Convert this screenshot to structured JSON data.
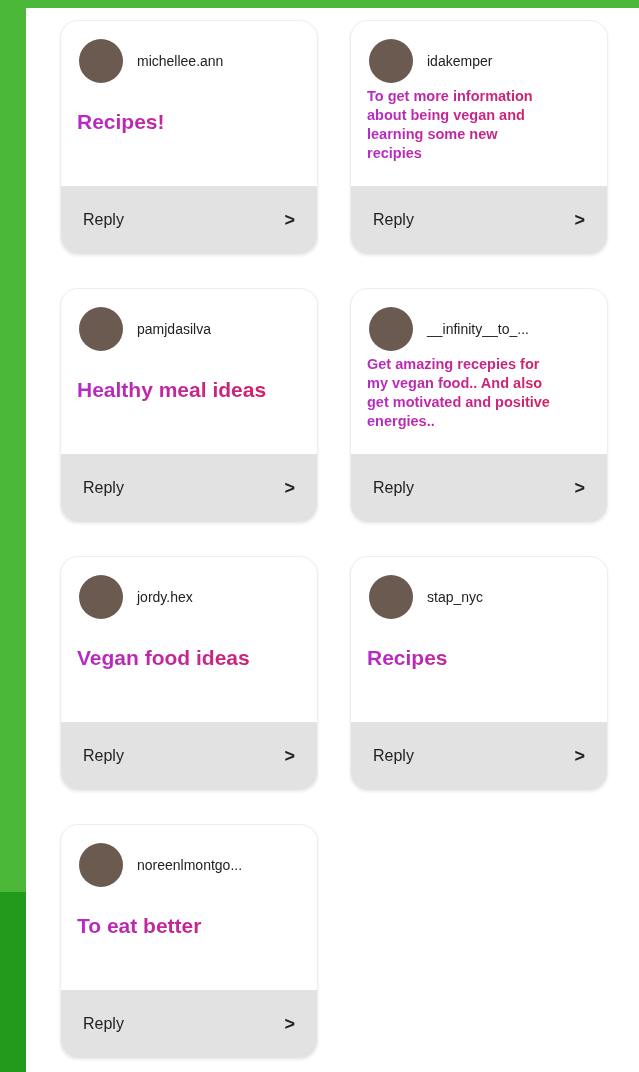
{
  "cards": [
    {
      "username": "michellee.ann",
      "message": "Recipes!",
      "kind": "large",
      "reply": "Reply",
      "chevron": ">"
    },
    {
      "username": "idakemper",
      "message": "To get more information about being vegan and learning some new recipies",
      "kind": "small",
      "reply": "Reply",
      "chevron": ">"
    },
    {
      "username": "pamjdasilva",
      "message": "Healthy meal ideas",
      "kind": "large",
      "reply": "Reply",
      "chevron": ">"
    },
    {
      "username": "__infinity__to_...",
      "message": "Get amazing recepies for my vegan food.. And also get motivated and positive energies..",
      "kind": "small",
      "reply": "Reply",
      "chevron": ">"
    },
    {
      "username": "jordy.hex",
      "message": "Vegan food ideas",
      "kind": "large",
      "reply": "Reply",
      "chevron": ">"
    },
    {
      "username": "stap_nyc",
      "message": "Recipes",
      "kind": "large",
      "reply": "Reply",
      "chevron": ">"
    },
    {
      "username": "noreenlmontgo...",
      "message": "To eat better",
      "kind": "large",
      "reply": "Reply",
      "chevron": ">"
    }
  ]
}
